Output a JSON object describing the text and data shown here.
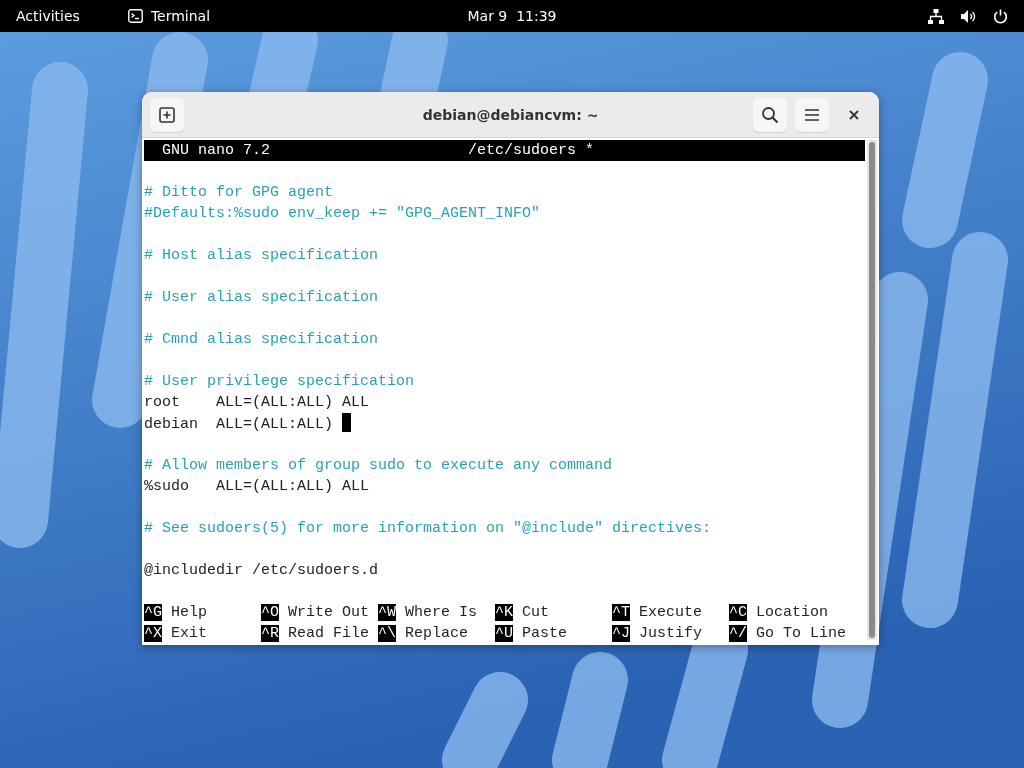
{
  "top_bar": {
    "activities": "Activities",
    "app": "Terminal",
    "clock": "Mar 9  11:39"
  },
  "window": {
    "title": "debian@debiancvm: ~"
  },
  "nano": {
    "header_left": "GNU nano 7.2",
    "header_center": "/etc/sudoers *",
    "lines": [
      {
        "kind": "blank"
      },
      {
        "kind": "comment",
        "text": "# Ditto for GPG agent"
      },
      {
        "kind": "comment",
        "text": "#Defaults:%sudo env_keep += \"GPG_AGENT_INFO\""
      },
      {
        "kind": "blank"
      },
      {
        "kind": "comment",
        "text": "# Host alias specification"
      },
      {
        "kind": "blank"
      },
      {
        "kind": "comment",
        "text": "# User alias specification"
      },
      {
        "kind": "blank"
      },
      {
        "kind": "comment",
        "text": "# Cmnd alias specification"
      },
      {
        "kind": "blank"
      },
      {
        "kind": "comment",
        "text": "# User privilege specification"
      },
      {
        "kind": "code",
        "text": "root    ALL=(ALL:ALL) ALL"
      },
      {
        "kind": "code",
        "text": "debian  ALL=(ALL:ALL) ",
        "cursor": true
      },
      {
        "kind": "blank"
      },
      {
        "kind": "comment",
        "text": "# Allow members of group sudo to execute any command"
      },
      {
        "kind": "code",
        "text": "%sudo   ALL=(ALL:ALL) ALL"
      },
      {
        "kind": "blank"
      },
      {
        "kind": "comment",
        "text": "# See sudoers(5) for more information on \"@include\" directives:"
      },
      {
        "kind": "blank"
      },
      {
        "kind": "code",
        "text": "@includedir /etc/sudoers.d"
      },
      {
        "kind": "blank"
      }
    ],
    "shortcuts": [
      [
        {
          "key": "^G",
          "label": "Help"
        },
        {
          "key": "^O",
          "label": "Write Out"
        },
        {
          "key": "^W",
          "label": "Where Is"
        },
        {
          "key": "^K",
          "label": "Cut"
        },
        {
          "key": "^T",
          "label": "Execute"
        },
        {
          "key": "^C",
          "label": "Location"
        }
      ],
      [
        {
          "key": "^X",
          "label": "Exit"
        },
        {
          "key": "^R",
          "label": "Read File"
        },
        {
          "key": "^\\",
          "label": "Replace"
        },
        {
          "key": "^U",
          "label": "Paste"
        },
        {
          "key": "^J",
          "label": "Justify"
        },
        {
          "key": "^/",
          "label": "Go To Line"
        }
      ]
    ]
  }
}
